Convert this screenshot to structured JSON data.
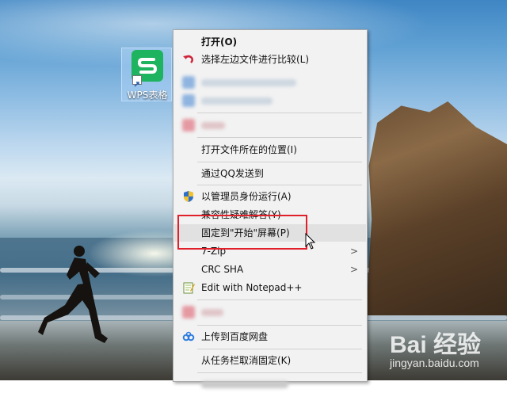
{
  "desktop": {
    "icon_label": "WPS表格",
    "icon_glyph": "S",
    "icon_color": "#1eb35e"
  },
  "menu": {
    "items": [
      {
        "label": "打开(O)",
        "bold": true
      },
      {
        "label": "选择左边文件进行比较(L)",
        "icon": "undo-arrow-icon"
      },
      {
        "label": "打开文件所在的位置(I)"
      },
      {
        "label": "通过QQ发送到"
      },
      {
        "label": "以管理员身份运行(A)",
        "icon": "uac-shield-icon"
      },
      {
        "label": "兼容性疑难解答(Y)"
      },
      {
        "label": "固定到\"开始\"屏幕(P)",
        "highlighted": true
      },
      {
        "label": "7-Zip",
        "submenu": true
      },
      {
        "label": "CRC SHA",
        "submenu": true
      },
      {
        "label": "Edit with Notepad++",
        "icon": "notepad-plus-plus-icon"
      },
      {
        "label": "上传到百度网盘",
        "icon": "baidu-netdisk-icon"
      },
      {
        "label": "从任务栏取消固定(K)"
      }
    ],
    "submenu_arrow": ">"
  },
  "watermark": {
    "logo": "Bai 经验",
    "sub": "jingyan.baidu.com"
  },
  "colors": {
    "menu_bg": "#f2f2f2",
    "highlight_bg": "#e1e1e1",
    "annotation_red": "#e0202a"
  }
}
